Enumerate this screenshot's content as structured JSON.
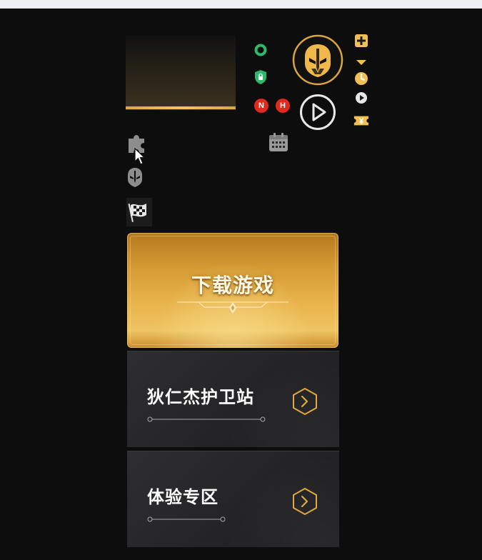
{
  "download": {
    "label": "下载游戏"
  },
  "menu": [
    {
      "label": "狄仁杰护卫站"
    },
    {
      "label": "体验专区"
    }
  ],
  "badges": {
    "n_label": "N",
    "h_label": "H"
  },
  "icons": {
    "status_ring": "green-ring-icon",
    "status_shield": "green-lock-shield-icon",
    "avatar": "helmet-avatar-icon",
    "play": "play-circle-icon",
    "plus": "plus-box-icon",
    "caret": "caret-down-icon",
    "clock": "clock-icon",
    "ticket": "ticket-yen-icon",
    "calendar": "calendar-icon",
    "puzzle": "puzzle-icon",
    "helmet": "helmet-icon",
    "flag": "checkered-flag-icon",
    "arrow": "chevron-right-hex-icon"
  },
  "colors": {
    "gold": "#f2bf55",
    "green": "#2fb76a",
    "red": "#e02a1e",
    "background": "#0d0d0d"
  }
}
